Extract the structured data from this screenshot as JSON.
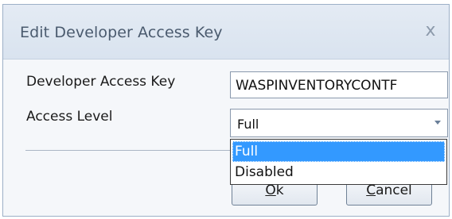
{
  "window": {
    "title": "Edit Developer Access Key",
    "close_label": "x"
  },
  "form": {
    "key_label": "Developer Access Key",
    "key_value": "WASPINVENTORYCONTF",
    "level_label": "Access Level",
    "level_value": "Full",
    "level_options": [
      "Full",
      "Disabled"
    ],
    "selected_option_index": 0
  },
  "buttons": {
    "ok_mnemonic": "O",
    "ok_rest": "k",
    "cancel_mnemonic": "C",
    "cancel_rest": "ancel"
  },
  "colors": {
    "selection": "#3399ff",
    "titlebar": "#dce5f0",
    "border": "#9db0c7"
  }
}
